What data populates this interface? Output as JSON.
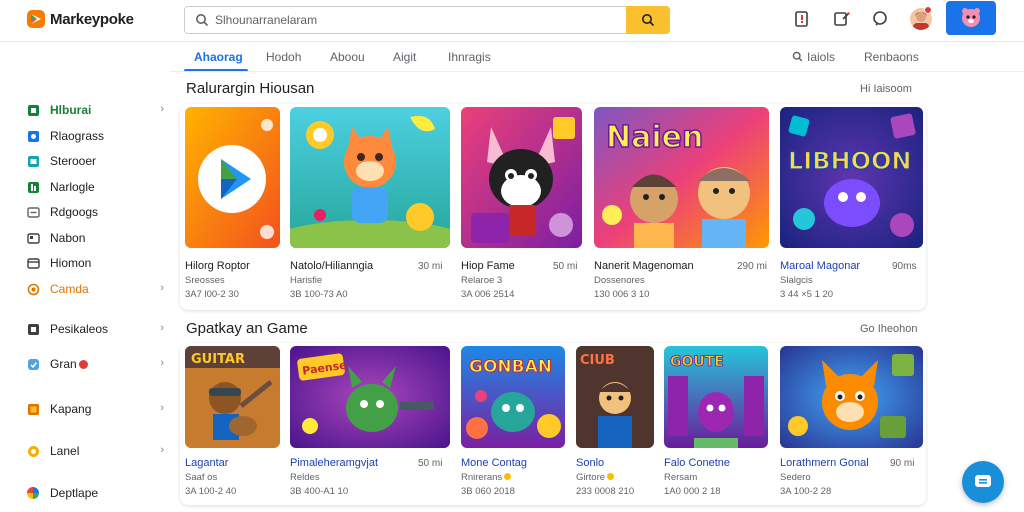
{
  "app": {
    "brand": "Markeypoke"
  },
  "search": {
    "placeholder": "Slhounarranelaram"
  },
  "tabs": [
    {
      "label": "Ahaorag",
      "active": true
    },
    {
      "label": "Hodoh"
    },
    {
      "label": "Aboou"
    },
    {
      "label": "Aigit"
    },
    {
      "label": "Ihnragis"
    },
    {
      "label": "Iaiols"
    },
    {
      "label": "Renbaons"
    }
  ],
  "sidebar": {
    "items": [
      {
        "label": "Hlburai",
        "icon": "home-icon",
        "color": "#188038",
        "active": true,
        "chevron": "›"
      },
      {
        "label": "Rlaograss",
        "icon": "games-icon",
        "color": "#1a73e8"
      },
      {
        "label": "Sterooer",
        "icon": "store-icon",
        "color": "#12a4af"
      },
      {
        "label": "Narlogle",
        "icon": "apps-icon",
        "color": "#188038"
      },
      {
        "label": "Rdgoogs",
        "icon": "books-icon",
        "color": "#5f6368"
      },
      {
        "label": "Nabon",
        "icon": "movies-icon",
        "color": "#5f6368"
      },
      {
        "label": "Hiomon",
        "icon": "kids-icon",
        "color": "#5f6368"
      },
      {
        "label": "Camda",
        "icon": "gift-icon",
        "color": "#e37400",
        "orange": true,
        "chevron": "›"
      },
      {
        "label": "Pesikaleos",
        "icon": "library-icon",
        "color": "#3c4043",
        "chevron": "›"
      },
      {
        "label": "Gran",
        "icon": "wishlist-icon",
        "color": "#1a73e8",
        "badge": true,
        "chevron": "›"
      },
      {
        "label": "Kapang",
        "icon": "payments-icon",
        "color": "#e37400",
        "chevron": "›"
      },
      {
        "label": "Lanel",
        "icon": "rewards-icon",
        "color": "#f9ab00",
        "chevron": "›"
      },
      {
        "label": "Deptlape",
        "icon": "pinwheel-icon",
        "color": "#1a73e8"
      }
    ]
  },
  "sections": [
    {
      "title": "Ralurargin Hiousan",
      "more": "Hi Iaisoom",
      "cards": [
        {
          "name": "Hilorg Roptor",
          "size": "",
          "line2": "Sreosses",
          "line3": "3A7 l00-2 30"
        },
        {
          "name": "Natolo/Hilianngia",
          "size": "30 mi",
          "line2": "Harisfie",
          "line3": "3B 100-73 A0"
        },
        {
          "name": "Hiop Fame",
          "size": "50 mi",
          "line2": "Relaroe 3",
          "line3": "3A 006 2514"
        },
        {
          "name": "Nanerit Magenoman",
          "size": "290 mi",
          "line2": "Dossenores",
          "line3": "130 006 3 10"
        },
        {
          "name": "Maroal Magonar",
          "size": "90ms",
          "line2": "Slalgcis",
          "line3": "3 44 ×5 1 20",
          "blue": true
        }
      ]
    },
    {
      "title": "Gpatkay an Game",
      "more": "Go Iheohon",
      "cards": [
        {
          "name": "Lagantar",
          "size": "",
          "line2": "Saaf os",
          "line3": "3A 100-2 40",
          "blue": true
        },
        {
          "name": "Pimaleheramgvjat",
          "size": "50 mi",
          "line2": "Reldes",
          "line3": "3B 400-A1 10",
          "blue": true
        },
        {
          "name": "Mone Contag",
          "size": "",
          "line2": "Rnirerans",
          "line3": "3B 060 2018",
          "blue": true,
          "star": true
        },
        {
          "name": "Sonlo",
          "size": "",
          "line2": "Girtore",
          "line3": "233 0008 210",
          "blue": true,
          "star": true
        },
        {
          "name": "Falo Conetne",
          "size": "",
          "line2": "Rersam",
          "line3": "1A0 000 2 18",
          "blue": true
        },
        {
          "name": "Lorathmern Gonal",
          "size": "90 mi",
          "line2": "Sedero",
          "line3": "3A 100-2 28"
        }
      ]
    }
  ],
  "thumbs": {
    "row1": [
      "PLAY",
      "",
      "",
      "Naien",
      "LIBHOON"
    ],
    "row2": [
      "GUITAR",
      "Paense",
      "GONBAN",
      "CIUB",
      "GOUTE",
      ""
    ]
  },
  "colors": {
    "accent": "#1a73e8",
    "search_button": "#fbc02d",
    "green": "#188038",
    "orange": "#e37400"
  }
}
